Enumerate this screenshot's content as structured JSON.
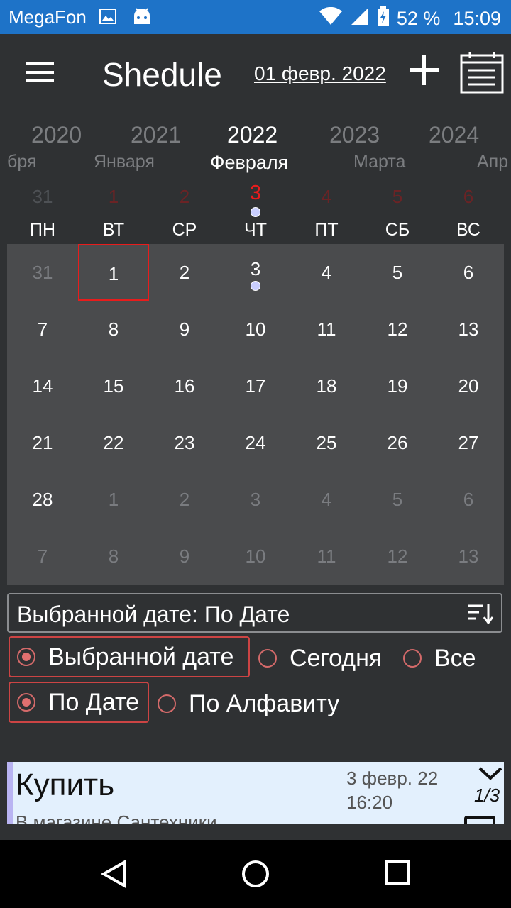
{
  "status": {
    "carrier": "MegaFon",
    "battery": "52 %",
    "time": "15:09"
  },
  "appbar": {
    "title": "Shedule",
    "date": "01 февр. 2022"
  },
  "years": [
    "2020",
    "2021",
    "2022",
    "2023",
    "2024"
  ],
  "months": [
    "бря",
    "Января",
    "Февраля",
    "Марта",
    "Апр"
  ],
  "top_days": [
    "31",
    "1",
    "2",
    "3",
    "4",
    "5",
    "6"
  ],
  "weekdays": [
    "ПН",
    "ВТ",
    "СР",
    "ЧТ",
    "ПТ",
    "СБ",
    "ВС"
  ],
  "calendar": [
    [
      "31",
      "1",
      "2",
      "3",
      "4",
      "5",
      "6"
    ],
    [
      "7",
      "8",
      "9",
      "10",
      "11",
      "12",
      "13"
    ],
    [
      "14",
      "15",
      "16",
      "17",
      "18",
      "19",
      "20"
    ],
    [
      "21",
      "22",
      "23",
      "24",
      "25",
      "26",
      "27"
    ],
    [
      "28",
      "1",
      "2",
      "3",
      "4",
      "5",
      "6"
    ],
    [
      "7",
      "8",
      "9",
      "10",
      "11",
      "12",
      "13"
    ]
  ],
  "sort": {
    "label": "Выбранной дате: По Дате"
  },
  "filter": {
    "selected_date": "Выбранной дате",
    "today": "Сегодня",
    "all": "Все"
  },
  "order": {
    "by_date": "По Дате",
    "alphabetical": "По Алфавиту"
  },
  "task": {
    "title": "Купить",
    "subtitle": "В магазине Сантехники",
    "date": "3 февр. 22",
    "time": "16:20",
    "count": "1/3"
  }
}
